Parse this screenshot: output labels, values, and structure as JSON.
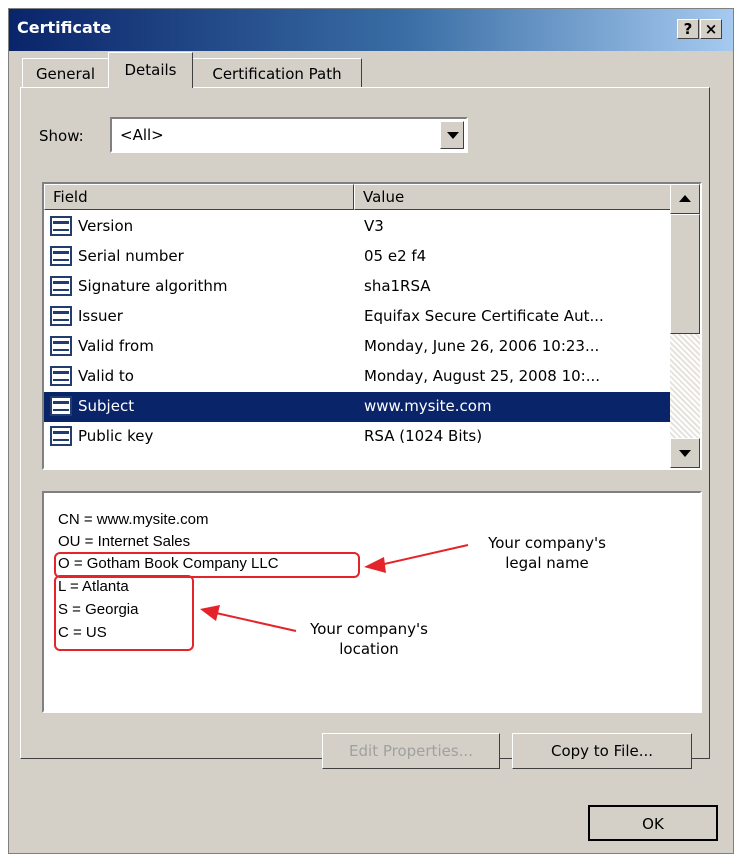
{
  "window": {
    "title": "Certificate",
    "help_label": "?",
    "close_label": "×"
  },
  "tabs": [
    {
      "label": "General"
    },
    {
      "label": "Details",
      "active": true
    },
    {
      "label": "Certification Path"
    }
  ],
  "show": {
    "label": "Show:",
    "value": "<All>"
  },
  "list": {
    "columns": [
      "Field",
      "Value"
    ],
    "rows": [
      {
        "field": "Version",
        "value": "V3"
      },
      {
        "field": "Serial number",
        "value": "05 e2 f4"
      },
      {
        "field": "Signature algorithm",
        "value": "sha1RSA"
      },
      {
        "field": "Issuer",
        "value": "Equifax Secure Certificate Aut..."
      },
      {
        "field": "Valid from",
        "value": "Monday, June 26, 2006 10:23..."
      },
      {
        "field": "Valid to",
        "value": "Monday, August 25, 2008 10:..."
      },
      {
        "field": "Subject",
        "value": "www.mysite.com",
        "selected": true
      },
      {
        "field": "Public key",
        "value": "RSA (1024 Bits)"
      }
    ]
  },
  "details": {
    "lines": [
      "CN = www.mysite.com",
      "OU = Internet Sales",
      "O = Gotham Book Company LLC",
      "L = Atlanta",
      "S = Georgia",
      "C = US"
    ],
    "callout_name": [
      "Your company's",
      "legal name"
    ],
    "callout_location": [
      "Your company's",
      "location"
    ],
    "annotation_color": "#e3242b"
  },
  "buttons": {
    "edit_properties": "Edit Properties...",
    "copy_to_file": "Copy to File...",
    "ok": "OK"
  }
}
